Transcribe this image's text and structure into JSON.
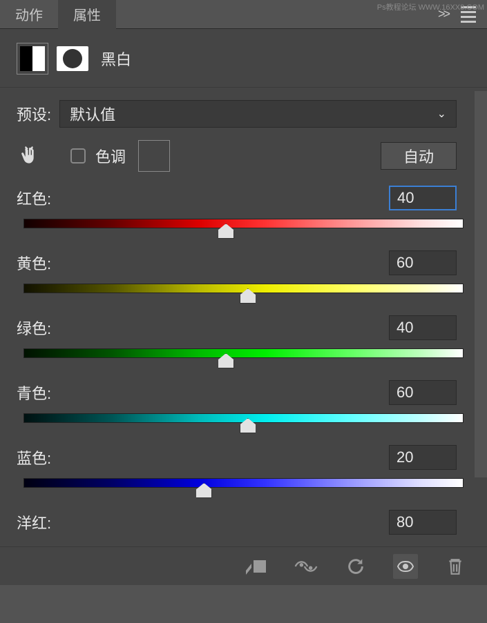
{
  "watermark": "Ps教程论坛 WWW.16XX8.COM",
  "tabs": {
    "actions": "动作",
    "properties": "属性"
  },
  "header": {
    "title": "黑白"
  },
  "preset": {
    "label": "预设:",
    "value": "默认值"
  },
  "tint": {
    "label": "色调",
    "auto_btn": "自动"
  },
  "sliders": [
    {
      "label": "红色:",
      "value": "40",
      "pos": 46,
      "grad": "grad-red",
      "selected": true
    },
    {
      "label": "黄色:",
      "value": "60",
      "pos": 51,
      "grad": "grad-yellow",
      "selected": false
    },
    {
      "label": "绿色:",
      "value": "40",
      "pos": 46,
      "grad": "grad-green",
      "selected": false
    },
    {
      "label": "青色:",
      "value": "60",
      "pos": 51,
      "grad": "grad-cyan",
      "selected": false
    },
    {
      "label": "蓝色:",
      "value": "20",
      "pos": 41,
      "grad": "grad-blue",
      "selected": false
    },
    {
      "label": "洋红:",
      "value": "80",
      "pos": null,
      "grad": null,
      "selected": false
    }
  ]
}
